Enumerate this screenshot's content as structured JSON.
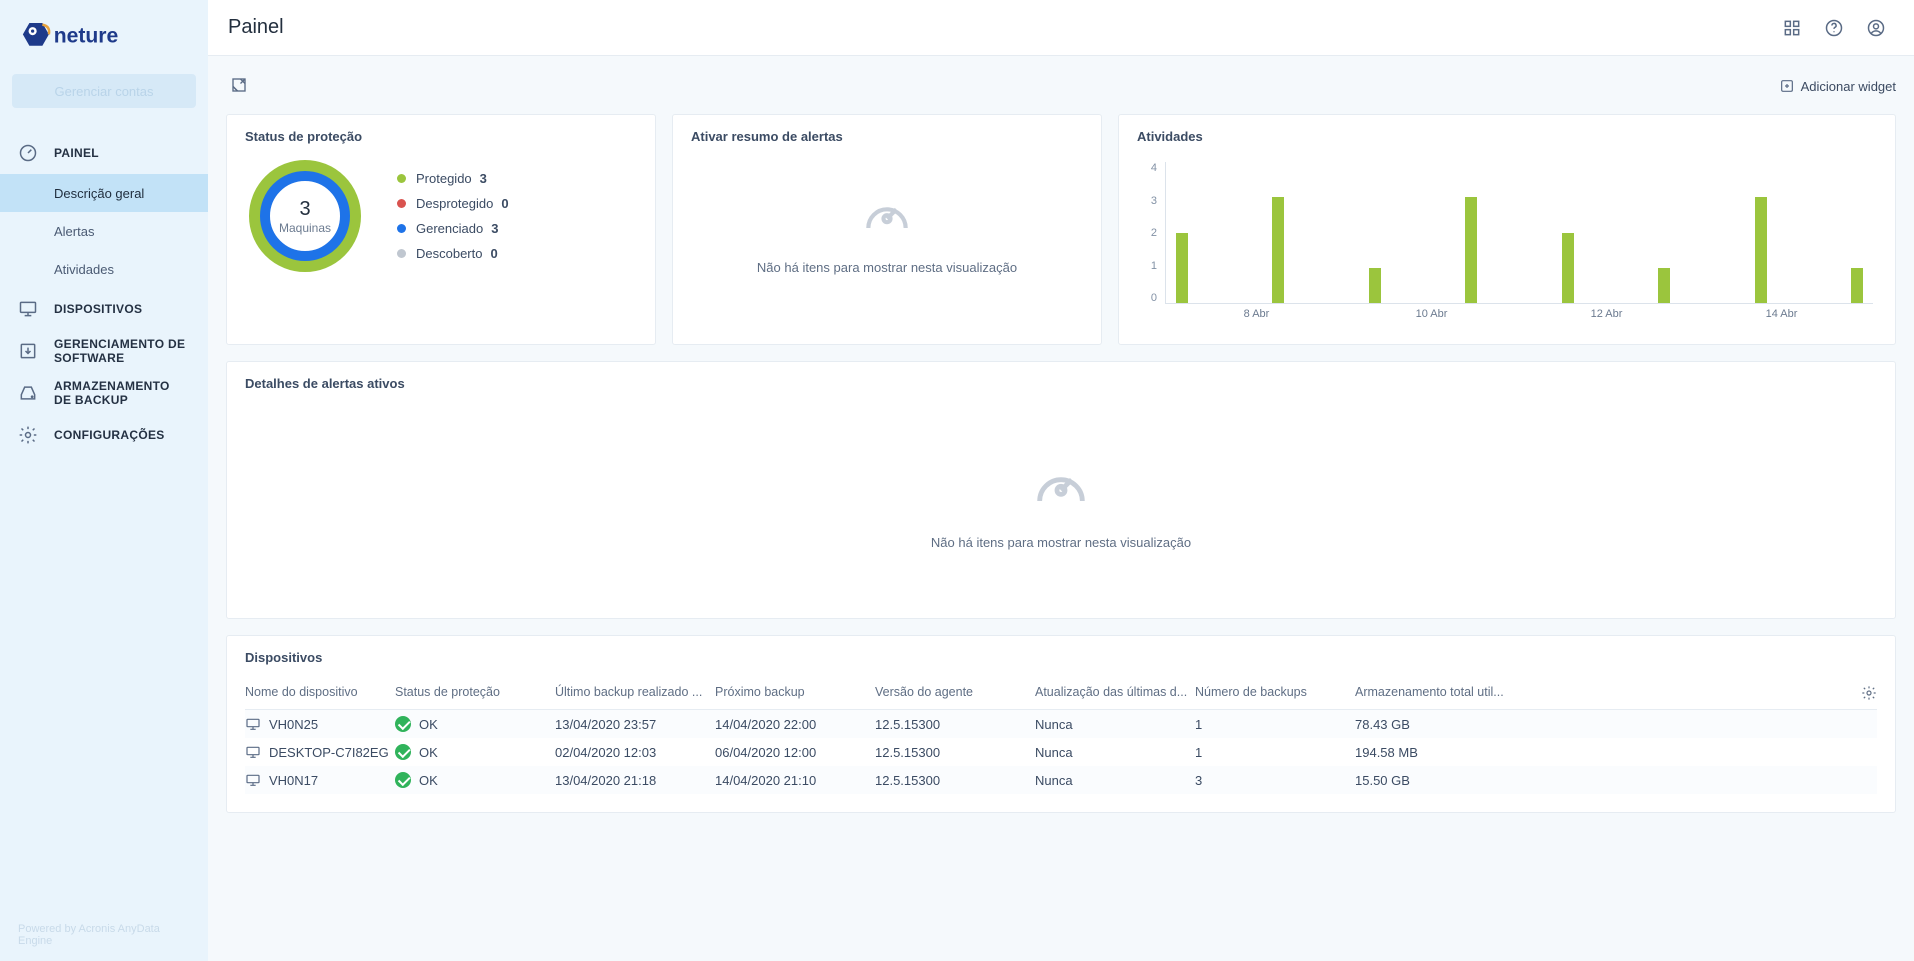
{
  "brand": {
    "name": "neture"
  },
  "sidebar": {
    "manage_label": "Gerenciar contas",
    "items": {
      "painel": "PAINEL",
      "dispositivos": "DISPOSITIVOS",
      "gerenciamento": "GERENCIAMENTO DE SOFTWARE",
      "armazenamento": "ARMAZENAMENTO DE BACKUP",
      "config": "CONFIGURAÇÕES"
    },
    "painel_sub": {
      "descricao": "Descrição geral",
      "alertas": "Alertas",
      "atividades": "Atividades"
    },
    "footer": "Powered by Acronis AnyData Engine"
  },
  "header": {
    "title": "Painel"
  },
  "toolbar": {
    "add_widget": "Adicionar widget"
  },
  "status_card": {
    "title": "Status de proteção",
    "total_num": "3",
    "total_label": "Maquinas",
    "legend": [
      {
        "label": "Protegido",
        "value": "3",
        "color": "#9bc53d"
      },
      {
        "label": "Desprotegido",
        "value": "0",
        "color": "#d9534f"
      },
      {
        "label": "Gerenciado",
        "value": "3",
        "color": "#1e73e8"
      },
      {
        "label": "Descoberto",
        "value": "0",
        "color": "#c0c7d0"
      }
    ]
  },
  "alerts_summary": {
    "title": "Ativar resumo de alertas",
    "empty_text": "Não há itens para mostrar nesta visualização"
  },
  "activities_card": {
    "title": "Atividades"
  },
  "chart_data": {
    "type": "bar",
    "ylim": [
      0,
      4
    ],
    "y_ticks": [
      "4",
      "3",
      "2",
      "1",
      "0"
    ],
    "bars": [
      2,
      3,
      1,
      3,
      2,
      1,
      3,
      1
    ],
    "x_labels": [
      "8 Abr",
      "10 Abr",
      "12 Abr",
      "14 Abr"
    ]
  },
  "alert_details": {
    "title": "Detalhes de alertas ativos",
    "empty_text": "Não há itens para mostrar nesta visualização"
  },
  "devices": {
    "title": "Dispositivos",
    "columns": {
      "name": "Nome do dispositivo",
      "status": "Status de proteção",
      "last": "Último backup realizado ...",
      "next": "Próximo backup",
      "version": "Versão do agente",
      "defs": "Atualização das últimas d...",
      "count": "Número de backups",
      "storage": "Armazenamento total util..."
    },
    "rows": [
      {
        "name": "VH0N25",
        "status": "OK",
        "last": "13/04/2020 23:57",
        "next": "14/04/2020 22:00",
        "version": "12.5.15300",
        "defs": "Nunca",
        "count": "1",
        "storage": "78.43 GB"
      },
      {
        "name": "DESKTOP-C7I82EG",
        "status": "OK",
        "last": "02/04/2020 12:03",
        "next": "06/04/2020 12:00",
        "version": "12.5.15300",
        "defs": "Nunca",
        "count": "1",
        "storage": "194.58 MB"
      },
      {
        "name": "VH0N17",
        "status": "OK",
        "last": "13/04/2020 21:18",
        "next": "14/04/2020 21:10",
        "version": "12.5.15300",
        "defs": "Nunca",
        "count": "3",
        "storage": "15.50 GB"
      }
    ]
  }
}
